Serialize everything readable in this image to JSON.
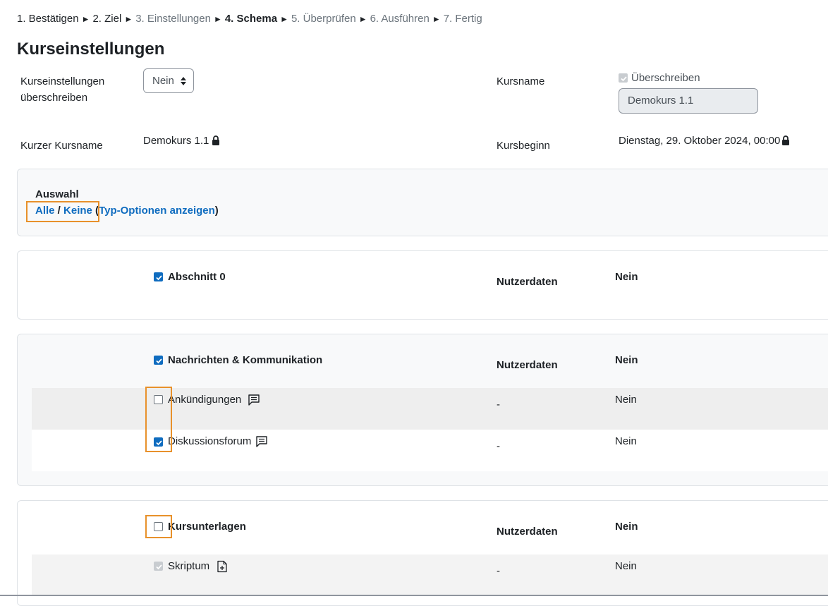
{
  "steps": [
    {
      "label": "1. Bestätigen",
      "state": "done"
    },
    {
      "label": "2. Ziel",
      "state": "done"
    },
    {
      "label": "3. Einstellungen",
      "state": "dim"
    },
    {
      "label": "4. Schema",
      "state": "current"
    },
    {
      "label": "5. Überprüfen",
      "state": "dim"
    },
    {
      "label": "6. Ausführen",
      "state": "dim"
    },
    {
      "label": "7. Fertig",
      "state": "dim"
    }
  ],
  "page_title": "Kurseinstellungen",
  "settings": {
    "overwrite_label_line1": "Kurseinstellungen",
    "overwrite_label_line2": "überschreiben",
    "overwrite_value": "Nein",
    "coursename_label": "Kursname",
    "overwrite_checkbox_label": "Überschreiben",
    "coursename_value": "Demokurs 1.1",
    "shortname_label": "Kurzer Kursname",
    "shortname_value": "Demokurs 1.1",
    "startdate_label": "Kursbeginn",
    "startdate_value": "Dienstag, 29. Oktober 2024, 00:00"
  },
  "selection": {
    "title": "Auswahl",
    "all": "Alle",
    "slash": " / ",
    "none": "Keine",
    "open_paren": " (",
    "type_options": "Typ-Optionen anzeigen",
    "close_paren": ")"
  },
  "sections": [
    {
      "name": "Abschnitt 0",
      "checked": true,
      "userdata_label": "Nutzerdaten",
      "userdata_value": "Nein"
    },
    {
      "name": "Nachrichten & Kommunikation",
      "checked": true,
      "userdata_label": "Nutzerdaten",
      "userdata_value": "Nein",
      "items": [
        {
          "name": "Ankündigungen",
          "checked": false,
          "userdata": "-",
          "value": "Nein",
          "icon": "forum-icon"
        },
        {
          "name": "Diskussionsforum",
          "checked": true,
          "userdata": "-",
          "value": "Nein",
          "icon": "forum-icon"
        }
      ]
    },
    {
      "name": "Kursunterlagen",
      "checked": false,
      "userdata_label": "Nutzerdaten",
      "userdata_value": "Nein",
      "items": [
        {
          "name": "Skriptum",
          "checked": true,
          "disabled": true,
          "userdata": "-",
          "value": "Nein",
          "icon": "file-icon"
        }
      ]
    }
  ],
  "colors": {
    "accent": "#0f6cbf",
    "highlight": "#e8912b"
  }
}
